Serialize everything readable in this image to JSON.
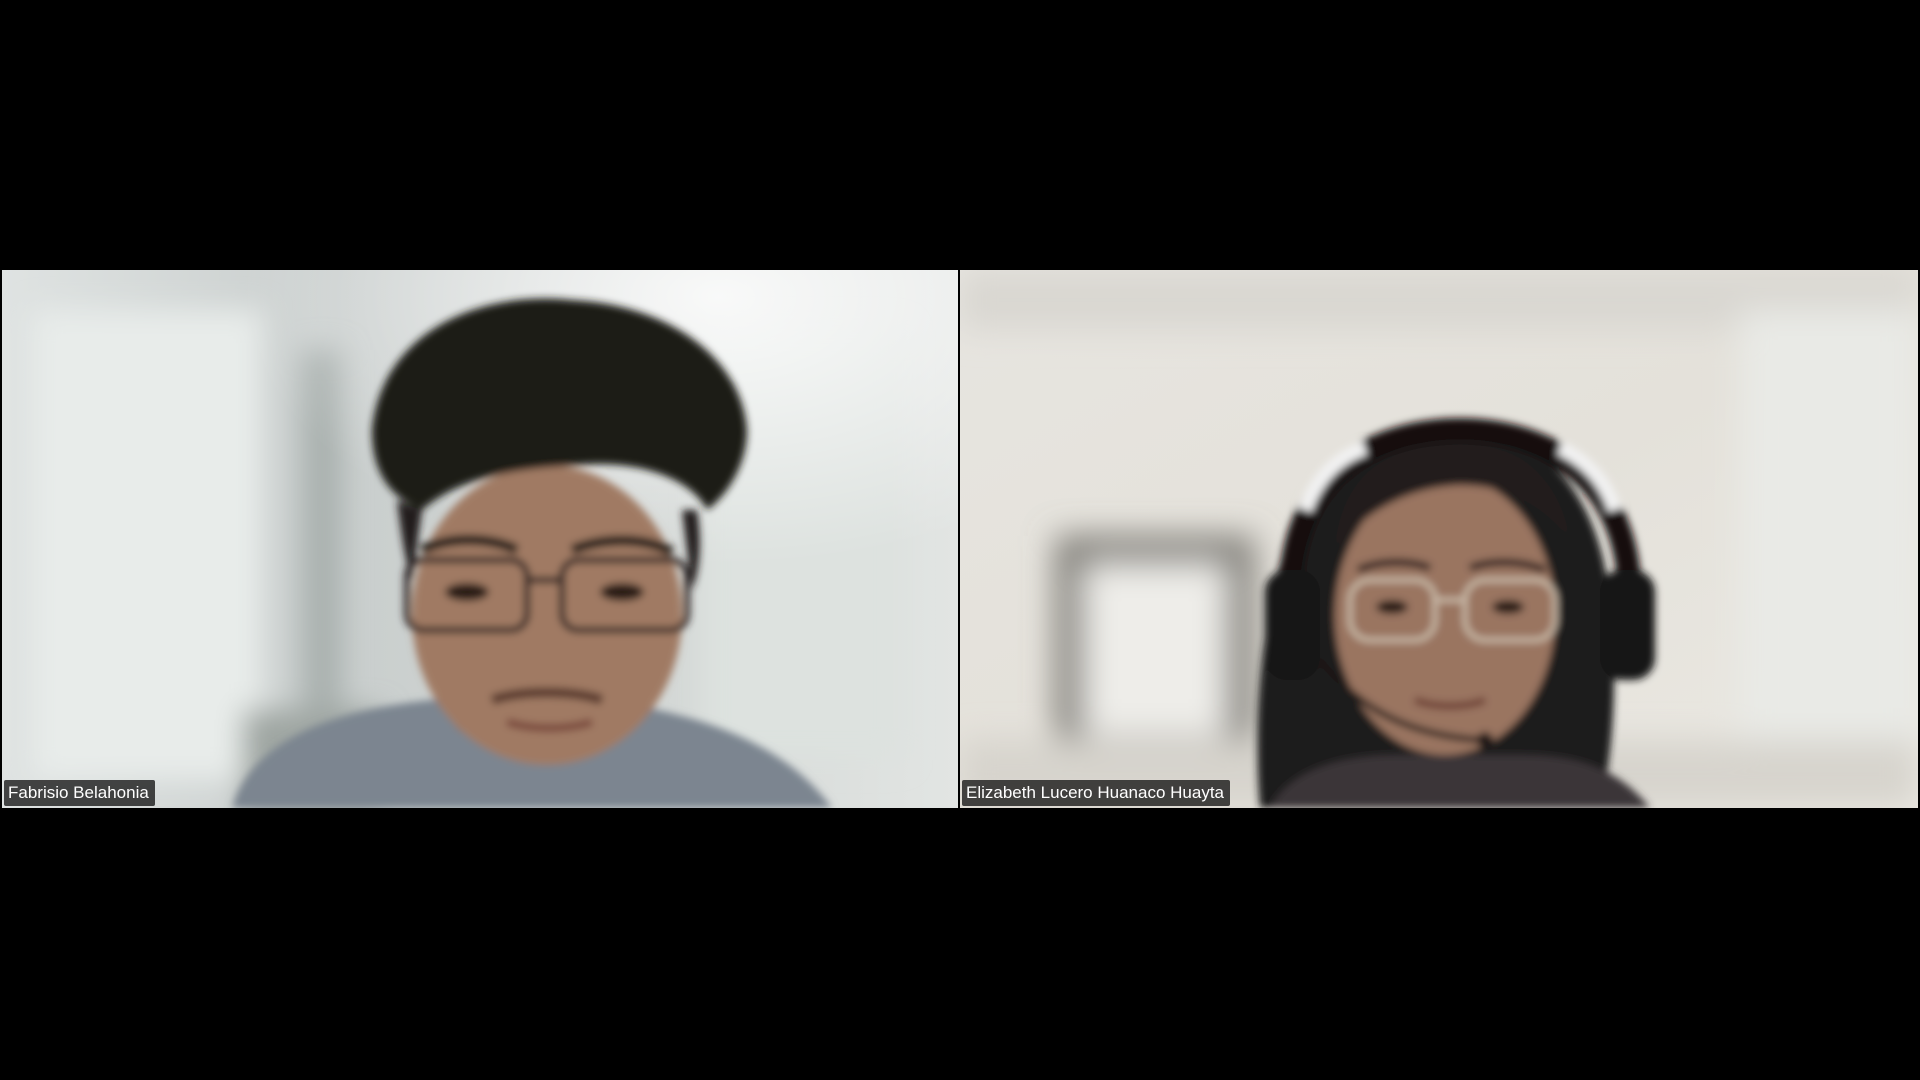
{
  "meeting": {
    "participants": [
      {
        "name": "Fabrisio Belahonia"
      },
      {
        "name": "Elizabeth Lucero Huanaco Huayta"
      }
    ]
  },
  "colors": {
    "background": "#000000",
    "name_label_bg": "#141414",
    "name_label_text": "#ffffff"
  },
  "icons": {
    "video_feed": "person-video-icon"
  }
}
